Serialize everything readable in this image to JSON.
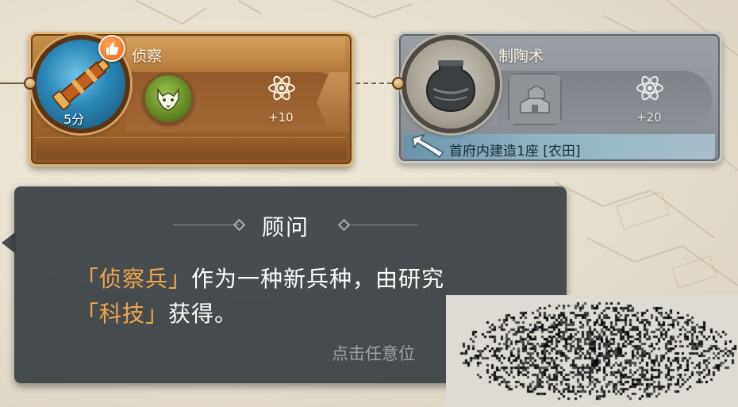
{
  "tech_active": {
    "name": "侦察",
    "duration": "5分",
    "research_points": "+10",
    "icon": "spyglass-icon",
    "unlock_icon": "wolf-head-icon",
    "badge_icon": "thumbs-up-icon"
  },
  "tech_locked": {
    "name": "制陶术",
    "research_points": "+20",
    "icon": "pottery-jar-icon",
    "building_icon": "farm-building-icon",
    "requirement": "首府内建造1座 [农田]"
  },
  "advisor": {
    "title": "顾问",
    "line1_highlight": "「侦察兵」",
    "line1_rest": "作为一种新兵种，由研究",
    "line2_highlight": "「科技」",
    "line2_rest": "获得。",
    "hint": "点击任意位"
  },
  "colors": {
    "highlight": "#f0a64d",
    "active_card": "#a86a2d",
    "locked_card": "#858b91",
    "dialog_bg": "#3c4246"
  }
}
